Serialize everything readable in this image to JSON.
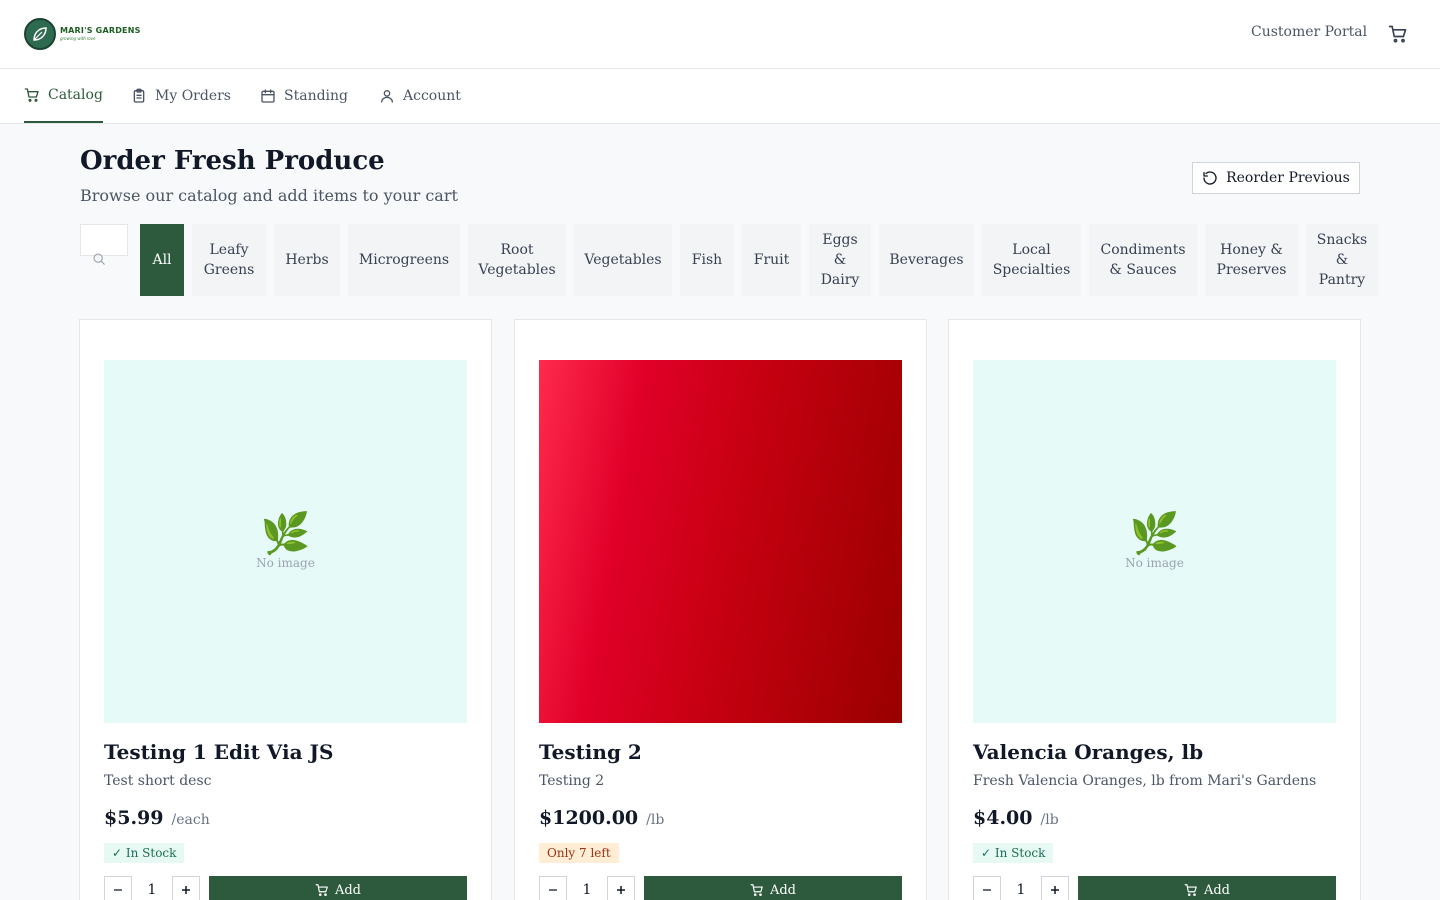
{
  "brand": {
    "name": "MARI'S GARDENS",
    "tagline": "growing with love"
  },
  "header": {
    "portal_label": "Customer Portal"
  },
  "nav": [
    {
      "label": "Catalog",
      "icon": "cart-icon",
      "active": true
    },
    {
      "label": "My Orders",
      "icon": "clipboard-icon",
      "active": false
    },
    {
      "label": "Standing",
      "icon": "calendar-icon",
      "active": false
    },
    {
      "label": "Account",
      "icon": "user-icon",
      "active": false
    }
  ],
  "page": {
    "title": "Order Fresh Produce",
    "subtitle": "Browse our catalog and add items to your cart",
    "reorder_label": "Reorder Previous"
  },
  "search": {
    "placeholder": ""
  },
  "categories": [
    {
      "label": "All",
      "active": true
    },
    {
      "label": "Leafy Greens"
    },
    {
      "label": "Herbs"
    },
    {
      "label": "Microgreens"
    },
    {
      "label": "Root Vegetables"
    },
    {
      "label": "Vegetables"
    },
    {
      "label": "Fish"
    },
    {
      "label": "Fruit"
    },
    {
      "label": "Eggs & Dairy"
    },
    {
      "label": "Beverages"
    },
    {
      "label": "Local Specialties"
    },
    {
      "label": "Condiments & Sauces"
    },
    {
      "label": "Honey & Preserves"
    },
    {
      "label": "Snacks & Pantry"
    }
  ],
  "products": [
    {
      "name": "Testing 1 Edit Via JS",
      "desc": "Test short desc",
      "price": "$5.99",
      "unit": "/each",
      "stock": "✓ In Stock",
      "stock_status": "in",
      "image": "placeholder",
      "placeholder_text": "No image",
      "qty": "1",
      "add_label": "Add"
    },
    {
      "name": "Testing 2",
      "desc": "Testing 2",
      "price": "$1200.00",
      "unit": "/lb",
      "stock": "Only 7 left",
      "stock_status": "low",
      "image": "photo",
      "qty": "1",
      "add_label": "Add"
    },
    {
      "name": "Valencia Oranges, lb",
      "desc": "Fresh Valencia Oranges, lb from Mari's Gardens",
      "price": "$4.00",
      "unit": "/lb",
      "stock": "✓ In Stock",
      "stock_status": "in",
      "image": "placeholder",
      "placeholder_text": "No image",
      "qty": "1",
      "add_label": "Add"
    }
  ],
  "colors": {
    "primary": "#2d5a3d",
    "placeholder_bg": "#e6faf8",
    "in_stock_bg": "#e6faf3",
    "low_stock_bg": "#ffedd5"
  }
}
